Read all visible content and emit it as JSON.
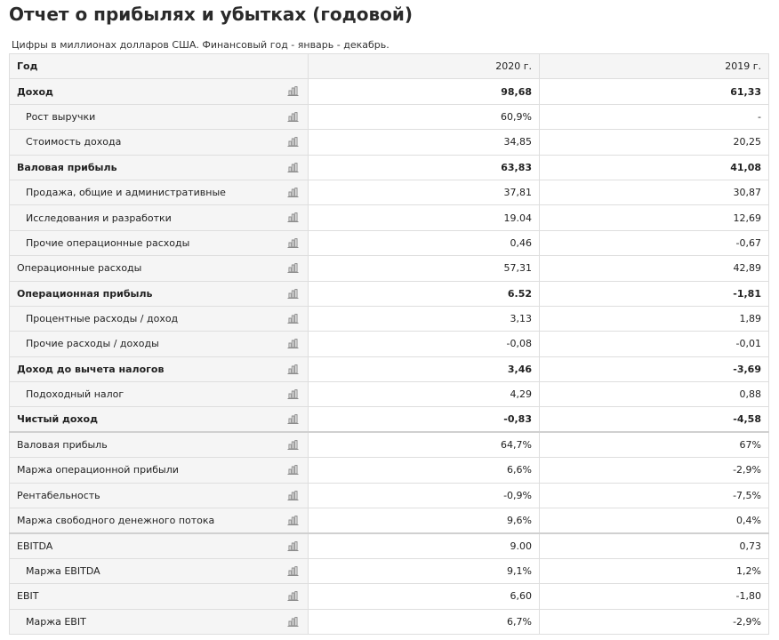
{
  "header": {
    "title": "Отчет о прибылях и убытках (годовой)",
    "subtitle": "Цифры в миллионах долларов США. Финансовый год - январь - декабрь."
  },
  "table": {
    "columns": [
      "Год",
      "2020 г.",
      "2019 г."
    ],
    "rows": [
      {
        "label": "Доход",
        "v1": "98,68",
        "v2": "61,33",
        "bold": true,
        "indent": false,
        "sep": false
      },
      {
        "label": "Рост выручки",
        "v1": "60,9%",
        "v2": "-",
        "bold": false,
        "indent": true,
        "sep": false
      },
      {
        "label": "Стоимость дохода",
        "v1": "34,85",
        "v2": "20,25",
        "bold": false,
        "indent": true,
        "sep": false
      },
      {
        "label": "Валовая прибыль",
        "v1": "63,83",
        "v2": "41,08",
        "bold": true,
        "indent": false,
        "sep": false
      },
      {
        "label": "Продажа, общие и административные",
        "v1": "37,81",
        "v2": "30,87",
        "bold": false,
        "indent": true,
        "sep": false
      },
      {
        "label": "Исследования и разработки",
        "v1": "19.04",
        "v2": "12,69",
        "bold": false,
        "indent": true,
        "sep": false
      },
      {
        "label": "Прочие операционные расходы",
        "v1": "0,46",
        "v2": "-0,67",
        "bold": false,
        "indent": true,
        "sep": false
      },
      {
        "label": "Операционные расходы",
        "v1": "57,31",
        "v2": "42,89",
        "bold": false,
        "indent": false,
        "sep": false
      },
      {
        "label": "Операционная прибыль",
        "v1": "6.52",
        "v2": "-1,81",
        "bold": true,
        "indent": false,
        "sep": false
      },
      {
        "label": "Процентные расходы / доход",
        "v1": "3,13",
        "v2": "1,89",
        "bold": false,
        "indent": true,
        "sep": false
      },
      {
        "label": "Прочие расходы / доходы",
        "v1": "-0,08",
        "v2": "-0,01",
        "bold": false,
        "indent": true,
        "sep": false
      },
      {
        "label": "Доход до вычета налогов",
        "v1": "3,46",
        "v2": "-3,69",
        "bold": true,
        "indent": false,
        "sep": false
      },
      {
        "label": "Подоходный налог",
        "v1": "4,29",
        "v2": "0,88",
        "bold": false,
        "indent": true,
        "sep": false
      },
      {
        "label": "Чистый доход",
        "v1": "-0,83",
        "v2": "-4,58",
        "bold": true,
        "indent": false,
        "sep": false
      },
      {
        "label": "Валовая прибыль",
        "v1": "64,7%",
        "v2": "67%",
        "bold": false,
        "indent": false,
        "sep": true
      },
      {
        "label": "Маржа операционной прибыли",
        "v1": "6,6%",
        "v2": "-2,9%",
        "bold": false,
        "indent": false,
        "sep": false
      },
      {
        "label": "Рентабельность",
        "v1": "-0,9%",
        "v2": "-7,5%",
        "bold": false,
        "indent": false,
        "sep": false
      },
      {
        "label": "Маржа свободного денежного потока",
        "v1": "9,6%",
        "v2": "0,4%",
        "bold": false,
        "indent": false,
        "sep": false
      },
      {
        "label": "EBITDA",
        "v1": "9.00",
        "v2": "0,73",
        "bold": false,
        "indent": false,
        "sep": true
      },
      {
        "label": "Маржа EBITDA",
        "v1": "9,1%",
        "v2": "1,2%",
        "bold": false,
        "indent": true,
        "sep": false
      },
      {
        "label": "EBIT",
        "v1": "6,60",
        "v2": "-1,80",
        "bold": false,
        "indent": false,
        "sep": false
      },
      {
        "label": "Маржа EBIT",
        "v1": "6,7%",
        "v2": "-2,9%",
        "bold": false,
        "indent": true,
        "sep": false
      }
    ]
  },
  "icons": {
    "row_chart": "bar-chart-icon"
  },
  "colors": {
    "label_bg": "#f5f5f5",
    "border": "#dedede",
    "icon": "#8a8a8a"
  }
}
